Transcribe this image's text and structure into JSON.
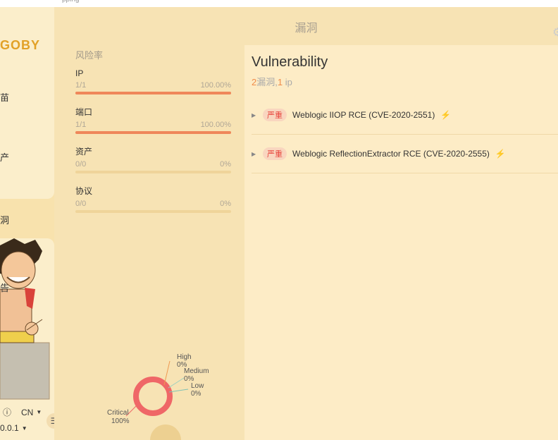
{
  "topbar": {
    "text": "pping"
  },
  "sidebar": {
    "logo": "GOBY",
    "items": [
      {
        "label": "苗"
      },
      {
        "label": "产"
      },
      {
        "label": "洞"
      },
      {
        "label": "告"
      }
    ],
    "footer": {
      "info_icon": "ⓘ",
      "language": "CN",
      "version": "0.0.1"
    }
  },
  "main": {
    "title": "漏洞"
  },
  "stats": {
    "title": "风险率",
    "items": [
      {
        "name": "IP",
        "count": "1/1",
        "percent": "100.00%",
        "fill": 1.0
      },
      {
        "name": "端口",
        "count": "1/1",
        "percent": "100.00%",
        "fill": 1.0
      },
      {
        "name": "资产",
        "count": "0/0",
        "percent": "0%",
        "fill": 0.0
      },
      {
        "name": "协议",
        "count": "0/0",
        "percent": "0%",
        "fill": 0.0
      }
    ]
  },
  "donut": {
    "labels": {
      "high_name": "High",
      "high_pct": "0%",
      "medium_name": "Medium",
      "medium_pct": "0%",
      "low_name": "Low",
      "low_pct": "0%",
      "critical_name": "Critical",
      "critical_pct": "100%"
    },
    "colors": {
      "critical": "#ef6767",
      "high": "#ef9a52",
      "medium": "#9ed0c0",
      "low": "#7fc2b4"
    }
  },
  "vulnerability": {
    "title": "Vulnerability",
    "summary": {
      "count": "2",
      "unit1": "漏洞,",
      "ip_count": "1",
      "unit2": " ip"
    },
    "rows": [
      {
        "severity": "严重",
        "name": "Weblogic IIOP RCE (CVE-2020-2551)",
        "icon": "bolt-icon"
      },
      {
        "severity": "严重",
        "name": "Weblogic ReflectionExtractor RCE (CVE-2020-2555)",
        "icon": "bolt-icon"
      }
    ]
  }
}
